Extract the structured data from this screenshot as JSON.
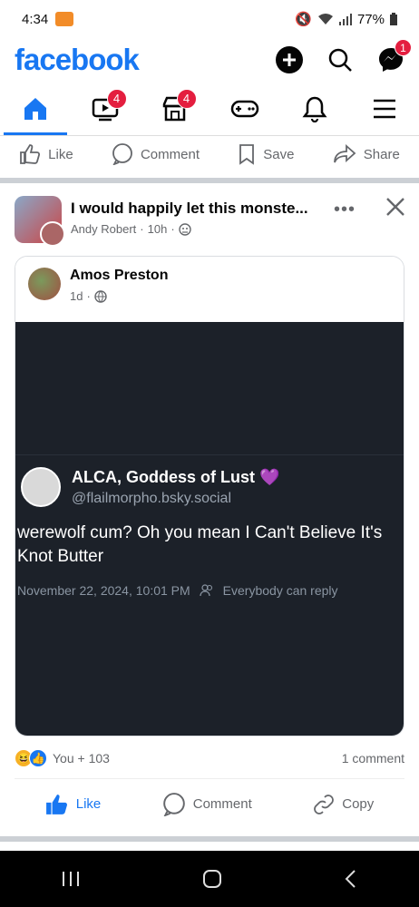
{
  "status": {
    "time": "4:34",
    "battery": "77%"
  },
  "header": {
    "logo": "facebook",
    "messenger_badge": "1"
  },
  "tabs": {
    "video_badge": "4",
    "marketplace_badge": "4"
  },
  "top_actions": {
    "like": "Like",
    "comment": "Comment",
    "save": "Save",
    "share": "Share"
  },
  "post": {
    "title": "I would happily let this monste...",
    "author": "Andy Robert",
    "time": "10h",
    "shared": {
      "name": "Amos Preston",
      "time": "1d",
      "bsky": {
        "name": "ALCA, Goddess of Lust 💜",
        "handle": "@flailmorpho.bsky.social",
        "body": "werewolf cum? Oh you mean I Can't Believe It's Knot Butter",
        "date": "November 22, 2024, 10:01 PM",
        "reply": "Everybody can reply"
      }
    },
    "reactions": "You + 103",
    "comments": "1 comment",
    "actions": {
      "like": "Like",
      "comment": "Comment",
      "copy": "Copy"
    }
  },
  "colors": {
    "brand": "#1877f2",
    "badge": "#e41e3f"
  }
}
